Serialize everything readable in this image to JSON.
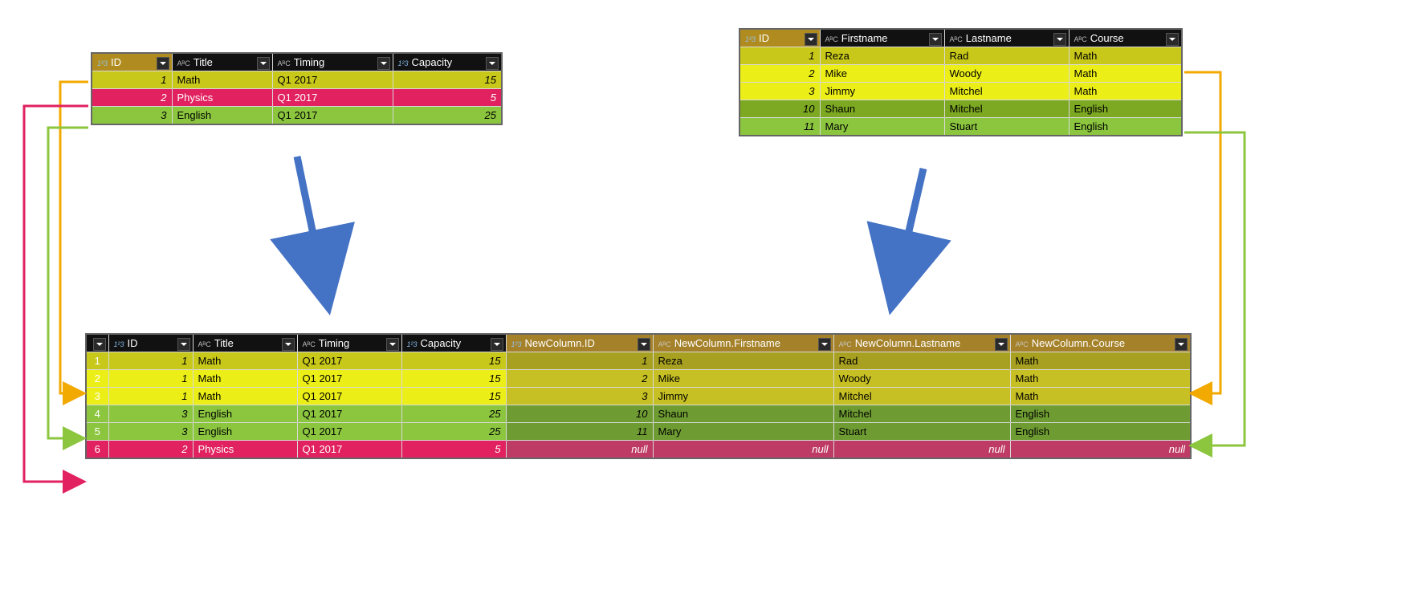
{
  "table_left": {
    "columns": [
      {
        "name": "ID",
        "type": "num"
      },
      {
        "name": "Title",
        "type": "txt"
      },
      {
        "name": "Timing",
        "type": "txt"
      },
      {
        "name": "Capacity",
        "type": "num"
      }
    ],
    "rows": [
      {
        "ID": 1,
        "Title": "Math",
        "Timing": "Q1 2017",
        "Capacity": 15,
        "color": "y"
      },
      {
        "ID": 2,
        "Title": "Physics",
        "Timing": "Q1 2017",
        "Capacity": 5,
        "color": "pink"
      },
      {
        "ID": 3,
        "Title": "English",
        "Timing": "Q1 2017",
        "Capacity": 25,
        "color": "g"
      }
    ]
  },
  "table_right": {
    "columns": [
      {
        "name": "ID",
        "type": "num"
      },
      {
        "name": "Firstname",
        "type": "txt"
      },
      {
        "name": "Lastname",
        "type": "txt"
      },
      {
        "name": "Course",
        "type": "txt"
      }
    ],
    "rows": [
      {
        "ID": 1,
        "Firstname": "Reza",
        "Lastname": "Rad",
        "Course": "Math",
        "color": "y"
      },
      {
        "ID": 2,
        "Firstname": "Mike",
        "Lastname": "Woody",
        "Course": "Math",
        "color": "y"
      },
      {
        "ID": 3,
        "Firstname": "Jimmy",
        "Lastname": "Mitchel",
        "Course": "Math",
        "color": "y"
      },
      {
        "ID": 10,
        "Firstname": "Shaun",
        "Lastname": "Mitchel",
        "Course": "English",
        "color": "g"
      },
      {
        "ID": 11,
        "Firstname": "Mary",
        "Lastname": "Stuart",
        "Course": "English",
        "color": "g"
      }
    ]
  },
  "table_merged": {
    "columns_left": [
      {
        "name": "ID",
        "type": "num"
      },
      {
        "name": "Title",
        "type": "txt"
      },
      {
        "name": "Timing",
        "type": "txt"
      },
      {
        "name": "Capacity",
        "type": "num"
      }
    ],
    "columns_right": [
      {
        "name": "NewColumn.ID",
        "type": "num"
      },
      {
        "name": "NewColumn.Firstname",
        "type": "txt"
      },
      {
        "name": "NewColumn.Lastname",
        "type": "txt"
      },
      {
        "name": "NewColumn.Course",
        "type": "txt"
      }
    ],
    "rows": [
      {
        "n": 1,
        "ID": 1,
        "Title": "Math",
        "Timing": "Q1 2017",
        "Capacity": 15,
        "NID": 1,
        "NF": "Reza",
        "NL": "Rad",
        "NC": "Math",
        "color": "y"
      },
      {
        "n": 2,
        "ID": 1,
        "Title": "Math",
        "Timing": "Q1 2017",
        "Capacity": 15,
        "NID": 2,
        "NF": "Mike",
        "NL": "Woody",
        "NC": "Math",
        "color": "y"
      },
      {
        "n": 3,
        "ID": 1,
        "Title": "Math",
        "Timing": "Q1 2017",
        "Capacity": 15,
        "NID": 3,
        "NF": "Jimmy",
        "NL": "Mitchel",
        "NC": "Math",
        "color": "y"
      },
      {
        "n": 4,
        "ID": 3,
        "Title": "English",
        "Timing": "Q1 2017",
        "Capacity": 25,
        "NID": 10,
        "NF": "Shaun",
        "NL": "Mitchel",
        "NC": "English",
        "color": "g"
      },
      {
        "n": 5,
        "ID": 3,
        "Title": "English",
        "Timing": "Q1 2017",
        "Capacity": 25,
        "NID": 11,
        "NF": "Mary",
        "NL": "Stuart",
        "NC": "English",
        "color": "g"
      },
      {
        "n": 6,
        "ID": 2,
        "Title": "Physics",
        "Timing": "Q1 2017",
        "Capacity": 5,
        "NID": null,
        "NF": null,
        "NL": null,
        "NC": null,
        "color": "pink"
      }
    ]
  },
  "null_label": "null",
  "icon_num": "1²3",
  "icon_txt": "AᴮC"
}
